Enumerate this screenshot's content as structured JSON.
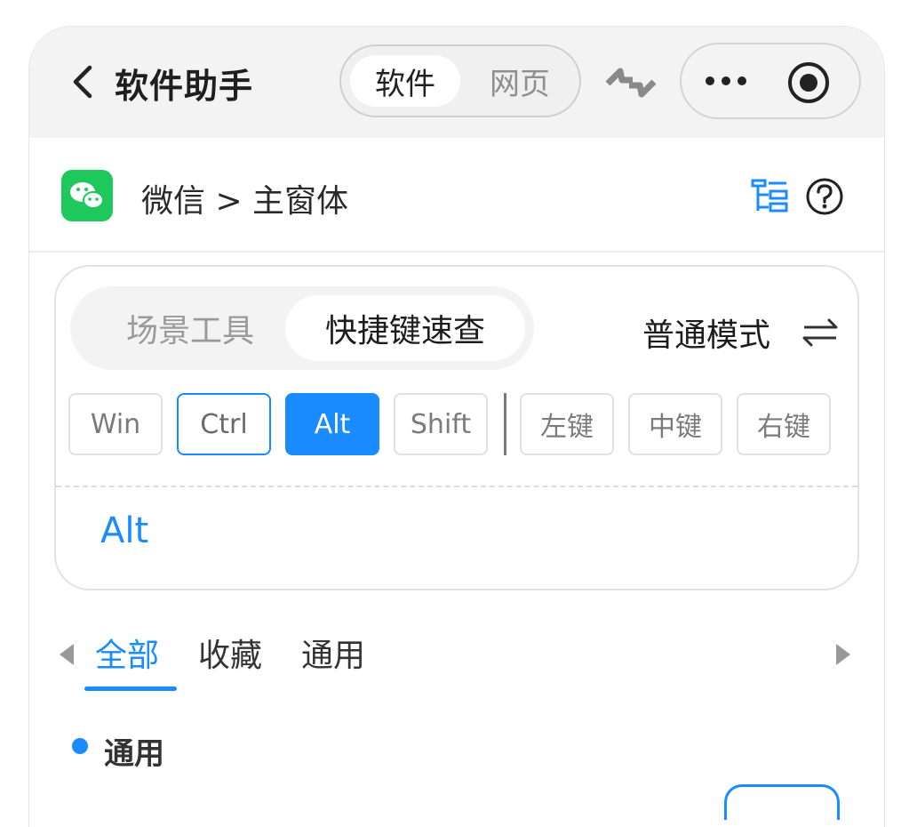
{
  "header": {
    "title": "软件助手",
    "segment": {
      "active": "软件",
      "inactive": "网页"
    },
    "icons": {
      "back": "chevron-left-icon",
      "sync": "sync-icon",
      "more": "more-dots-icon",
      "record": "record-icon"
    }
  },
  "breadcrumb": {
    "app_icon": "wechat-logo",
    "text": "微信 > 主窗体",
    "icons": {
      "tree": "tree-list-icon",
      "help": "help-circle-icon"
    }
  },
  "card": {
    "tabs": [
      {
        "label": "场景工具",
        "active": false
      },
      {
        "label": "快捷键速查",
        "active": true
      }
    ],
    "mode_label": "普通模式",
    "mode_icon": "swap-arrows-icon",
    "keys": [
      {
        "label": "Win",
        "state": "normal"
      },
      {
        "label": "Ctrl",
        "state": "outline"
      },
      {
        "label": "Alt",
        "state": "selected"
      },
      {
        "label": "Shift",
        "state": "normal"
      },
      {
        "label": "左键",
        "state": "normal"
      },
      {
        "label": "中键",
        "state": "normal"
      },
      {
        "label": "右键",
        "state": "normal"
      }
    ],
    "combo": "Alt"
  },
  "categories": {
    "items": [
      {
        "label": "全部",
        "active": true
      },
      {
        "label": "收藏",
        "active": false
      },
      {
        "label": "通用",
        "active": false
      }
    ]
  },
  "section": {
    "title": "通用"
  },
  "colors": {
    "accent": "#1a8cff",
    "wechat": "#1fc85a",
    "topbar": "#f4f3f3"
  }
}
